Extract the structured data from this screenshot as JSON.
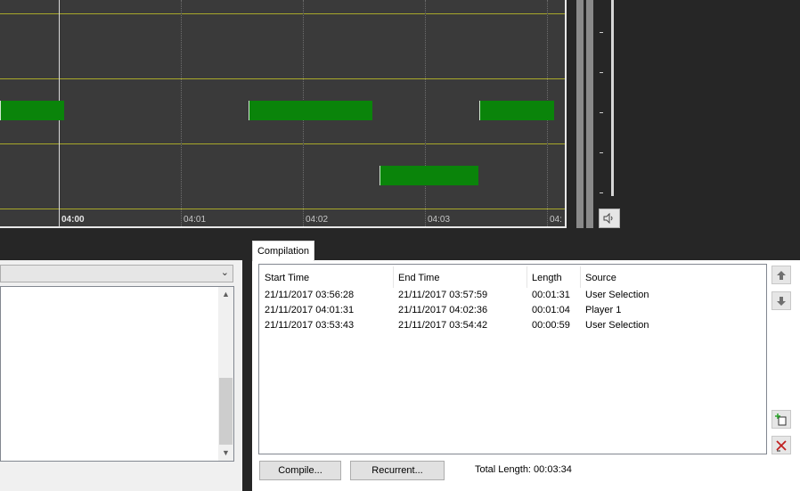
{
  "timeline": {
    "ticks": [
      "04:00",
      "04:01",
      "04:02",
      "04:03",
      "04:"
    ]
  },
  "compilation": {
    "tab_label": "Compilation",
    "columns": [
      "Start Time",
      "End Time",
      "Length",
      "Source"
    ],
    "rows": [
      {
        "start": "21/11/2017 03:56:28",
        "end": "21/11/2017 03:57:59",
        "length": "00:01:31",
        "source": "User Selection"
      },
      {
        "start": "21/11/2017 04:01:31",
        "end": "21/11/2017 04:02:36",
        "length": "00:01:04",
        "source": "Player 1"
      },
      {
        "start": "21/11/2017 03:53:43",
        "end": "21/11/2017 03:54:42",
        "length": "00:00:59",
        "source": "User Selection"
      }
    ],
    "compile_label": "Compile...",
    "recurrent_label": "Recurrent...",
    "total_length": "Total Length: 00:03:34"
  },
  "colors": {
    "segment": "#0a840a",
    "track_line": "#a8a82a",
    "timeline_bg": "#3a3a3a"
  },
  "icons": [
    "speaker-icon",
    "move-up-icon",
    "move-down-icon",
    "add-clip-icon",
    "delete-clip-icon"
  ]
}
